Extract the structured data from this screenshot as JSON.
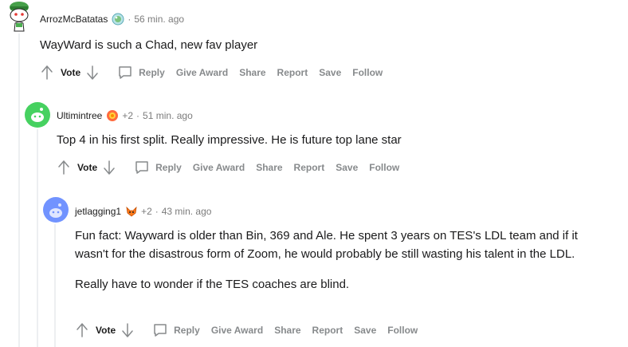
{
  "comments": [
    {
      "username": "ArrozMcBatatas",
      "flair_icon": "bubble-award-icon",
      "points": "",
      "separator": "·",
      "time": "56 min. ago",
      "body": [
        "WayWard is such a Chad, new fav player"
      ]
    },
    {
      "username": "Ultimintree",
      "flair_icon": "flower-award-icon",
      "points": "+2",
      "separator": "·",
      "time": "51 min. ago",
      "body": [
        "Top 4 in his first split. Really impressive. He is future top lane star"
      ]
    },
    {
      "username": "jetlagging1",
      "flair_icon": "fox-award-icon",
      "points": "+2",
      "separator": "·",
      "time": "43 min. ago",
      "body": [
        "Fun fact: Wayward is older than Bin, 369 and Ale. He spent 3 years on TES's LDL team and if it wasn't for the disastrous form of Zoom, he would probably be still wasting his talent in the LDL.",
        "Really have to wonder if the TES coaches are blind."
      ]
    }
  ],
  "actions": {
    "vote": "Vote",
    "reply": "Reply",
    "give_award": "Give Award",
    "share": "Share",
    "report": "Report",
    "save": "Save",
    "follow": "Follow"
  },
  "colors": {
    "meta_gray": "#7c7c7c",
    "action_gray": "#878a8c",
    "thread_line": "#edeff1",
    "avatar_green": "#46d160",
    "avatar_blue": "#7193ff"
  }
}
